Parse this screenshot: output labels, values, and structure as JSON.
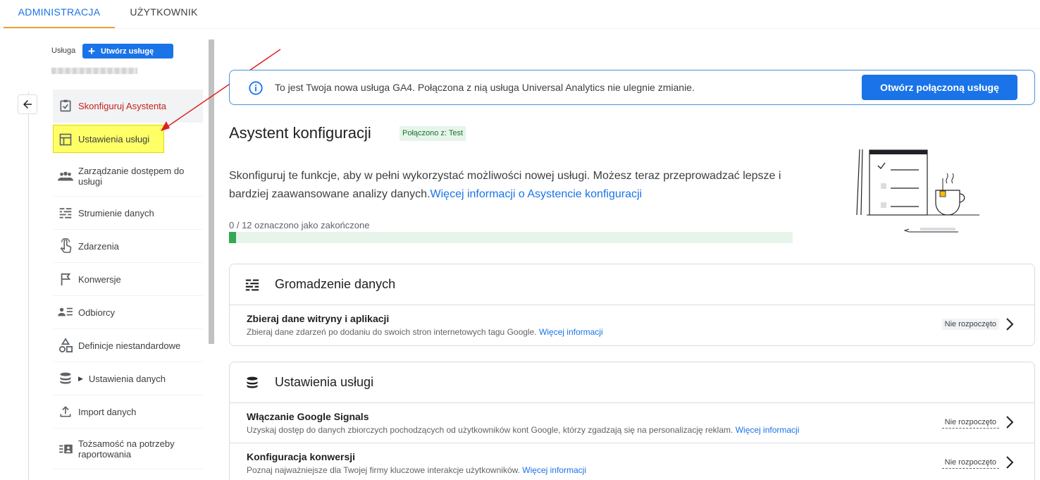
{
  "tabs": {
    "admin": "ADMINISTRACJA",
    "user": "UŻYTKOWNIK"
  },
  "sidebar": {
    "property_label": "Usługa",
    "create_button": "Utwórz usługę",
    "items": [
      {
        "label": "Skonfiguruj Asystenta",
        "icon": "checklist-icon"
      },
      {
        "label": "Ustawienia usługi",
        "icon": "layout-icon"
      },
      {
        "label": "Zarządzanie dostępem do usługi",
        "icon": "people-icon"
      },
      {
        "label": "Strumienie danych",
        "icon": "streams-icon"
      },
      {
        "label": "Zdarzenia",
        "icon": "touch-icon"
      },
      {
        "label": "Konwersje",
        "icon": "flag-icon"
      },
      {
        "label": "Odbiorcy",
        "icon": "audience-icon"
      },
      {
        "label": "Definicje niestandardowe",
        "icon": "shapes-icon"
      },
      {
        "label": "Ustawienia danych",
        "icon": "database-icon"
      },
      {
        "label": "Import danych",
        "icon": "upload-icon"
      },
      {
        "label": "Tożsamość na potrzeby raportowania",
        "icon": "id-card-icon"
      }
    ]
  },
  "banner": {
    "text": "To jest Twoja nowa usługa GA4. Połączona z nią usługa Universal Analytics nie ulegnie zmianie.",
    "button": "Otwórz połączoną usługę"
  },
  "main": {
    "title": "Asystent konfiguracji",
    "chip": "Połączono z: Test",
    "description": "Skonfiguruj te funkcje, aby w pełni wykorzystać możliwości nowej usługi. Możesz teraz przeprowadzać lepsze i bardziej zaawansowane analizy danych.",
    "description_link": "Więcej informacji o Asystencie konfiguracji",
    "progress_label": "0 / 12 oznaczono jako zakończone",
    "progress_fraction": 0.012
  },
  "cards": [
    {
      "title": "Gromadzenie danych",
      "icon": "streams-icon",
      "rows": [
        {
          "title": "Zbieraj dane witryny i aplikacji",
          "subtitle": "Zbieraj dane zdarzeń po dodaniu do swoich stron internetowych tagu Google.",
          "link": "Więcej informacji",
          "status": "Nie rozpoczęto"
        }
      ]
    },
    {
      "title": "Ustawienia usługi",
      "icon": "database-icon",
      "rows": [
        {
          "title": "Włączanie Google Signals",
          "subtitle": "Uzyskaj dostęp do danych zbiorczych pochodzących od użytkowników kont Google, którzy zgadzają się na personalizację reklam.",
          "link": "Więcej informacji",
          "status": "Nie rozpoczęto"
        },
        {
          "title": "Konfiguracja konwersji",
          "subtitle": "Poznaj najważniejsze dla Twojej firmy kluczowe interakcje użytkowników.",
          "link": "Więcej informacji",
          "status": "Nie rozpoczęto"
        }
      ]
    }
  ],
  "colors": {
    "accent": "#1a73e8",
    "active_nav": "#c5221f",
    "highlight": "#ffff66",
    "annotation_arrow": "#e02020"
  }
}
